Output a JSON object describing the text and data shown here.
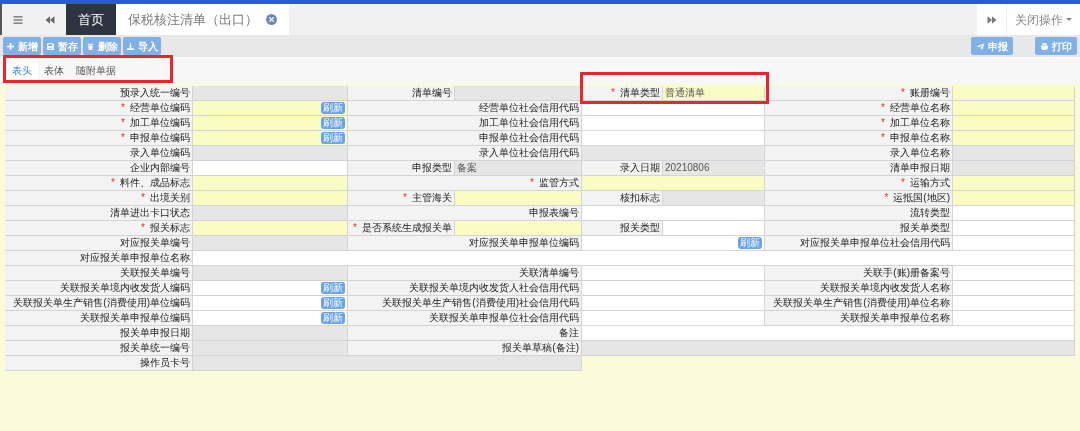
{
  "top_tabs": [
    {
      "kind": "menu"
    },
    {
      "kind": "back"
    },
    {
      "kind": "text",
      "label": "首页",
      "selected": true
    },
    {
      "kind": "text",
      "label": "保税核注清单（出口）",
      "selected": false,
      "closable": true
    }
  ],
  "top_right": {
    "close_ops": "关闭操作"
  },
  "toolbar": {
    "left": [
      {
        "kind": "plus",
        "label": "新增"
      },
      {
        "kind": "save",
        "label": "暂存"
      },
      {
        "kind": "trash",
        "label": "删除"
      },
      {
        "kind": "import",
        "label": "导入"
      }
    ],
    "right": [
      {
        "kind": "send",
        "label": "申报"
      },
      {
        "kind": "print",
        "label": "打印"
      }
    ]
  },
  "sub_tabs": [
    {
      "label": "表头",
      "selected": true
    },
    {
      "label": "表体",
      "selected": false
    },
    {
      "label": "随附单据",
      "selected": false
    }
  ],
  "form_rows": [
    {
      "kind": "eight",
      "cells": [
        {
          "kind": "label",
          "text": "预录入统一编号"
        },
        {
          "kind": "readonly"
        },
        {
          "kind": "label",
          "text": "清单编号"
        },
        {
          "kind": "readonly"
        },
        {
          "kind": "label",
          "text": "清单类型",
          "mark": "*"
        },
        {
          "kind": "required",
          "value": "普通清单"
        },
        {
          "kind": "label",
          "text": "账册编号",
          "mark": "*"
        },
        {
          "kind": "required"
        }
      ]
    },
    {
      "kind": "six",
      "cells": [
        {
          "kind": "label",
          "text": "经营单位编码",
          "mark": "*"
        },
        {
          "kind": "required",
          "refresh": "刷新"
        },
        {
          "kind": "label",
          "text": "经营单位社会信用代码"
        },
        {
          "kind": "editable"
        },
        {
          "kind": "label",
          "text": "经营单位名称",
          "mark": "*"
        },
        {
          "kind": "required"
        }
      ]
    },
    {
      "kind": "six",
      "cells": [
        {
          "kind": "label",
          "text": "加工单位编码",
          "mark": "*"
        },
        {
          "kind": "required",
          "refresh": "刷新"
        },
        {
          "kind": "label",
          "text": "加工单位社会信用代码"
        },
        {
          "kind": "editable"
        },
        {
          "kind": "label",
          "text": "加工单位名称",
          "mark": "*"
        },
        {
          "kind": "required"
        }
      ]
    },
    {
      "kind": "six",
      "cells": [
        {
          "kind": "label",
          "text": "申报单位编码",
          "mark": "*"
        },
        {
          "kind": "required",
          "refresh": "刷新"
        },
        {
          "kind": "label",
          "text": "申报单位社会信用代码"
        },
        {
          "kind": "editable"
        },
        {
          "kind": "label",
          "text": "申报单位名称",
          "mark": "*"
        },
        {
          "kind": "required"
        }
      ]
    },
    {
      "kind": "six",
      "cells": [
        {
          "kind": "label",
          "text": "录入单位编码"
        },
        {
          "kind": "readonly"
        },
        {
          "kind": "label",
          "text": "录入单位社会信用代码"
        },
        {
          "kind": "readonly"
        },
        {
          "kind": "label",
          "text": "录入单位名称"
        },
        {
          "kind": "readonly"
        }
      ]
    },
    {
      "kind": "eight",
      "cells": [
        {
          "kind": "label",
          "text": "企业内部编号"
        },
        {
          "kind": "editable"
        },
        {
          "kind": "label",
          "text": "申报类型"
        },
        {
          "kind": "readonly",
          "value": "备案"
        },
        {
          "kind": "label",
          "text": "录入日期"
        },
        {
          "kind": "readonly",
          "value": "20210806"
        },
        {
          "kind": "label",
          "text": "清单申报日期"
        },
        {
          "kind": "readonly"
        }
      ]
    },
    {
      "kind": "six",
      "cells": [
        {
          "kind": "label",
          "text": "料件、成品标志",
          "mark": "*"
        },
        {
          "kind": "required"
        },
        {
          "kind": "label",
          "text": "监管方式",
          "mark": "*"
        },
        {
          "kind": "required"
        },
        {
          "kind": "label",
          "text": "运输方式",
          "mark": "*"
        },
        {
          "kind": "required"
        }
      ]
    },
    {
      "kind": "eight",
      "cells": [
        {
          "kind": "label",
          "text": "出境关别",
          "mark": "*"
        },
        {
          "kind": "required"
        },
        {
          "kind": "label",
          "text": "主管海关",
          "mark": "*"
        },
        {
          "kind": "required"
        },
        {
          "kind": "label",
          "text": "核扣标志"
        },
        {
          "kind": "readonly"
        },
        {
          "kind": "label",
          "text": "运抵国(地区)",
          "mark": "*"
        },
        {
          "kind": "required"
        }
      ]
    },
    {
      "kind": "six",
      "cells": [
        {
          "kind": "label",
          "text": "清单进出卡口状态"
        },
        {
          "kind": "readonly"
        },
        {
          "kind": "label",
          "text": "申报表编号"
        },
        {
          "kind": "editable"
        },
        {
          "kind": "label",
          "text": "流转类型"
        },
        {
          "kind": "editable"
        }
      ]
    },
    {
      "kind": "eight",
      "cells": [
        {
          "kind": "label",
          "text": "报关标志",
          "mark": "*"
        },
        {
          "kind": "required"
        },
        {
          "kind": "label",
          "text": "是否系统生成报关单",
          "mark": "*"
        },
        {
          "kind": "required"
        },
        {
          "kind": "label",
          "text": "报关类型"
        },
        {
          "kind": "editable"
        },
        {
          "kind": "label",
          "text": "报关单类型"
        },
        {
          "kind": "editable"
        }
      ]
    },
    {
      "kind": "six",
      "cells": [
        {
          "kind": "label",
          "text": "对应报关单编号"
        },
        {
          "kind": "readonly"
        },
        {
          "kind": "label",
          "text": "对应报关单申报单位编码"
        },
        {
          "kind": "editable",
          "refresh": "刷新"
        },
        {
          "kind": "label",
          "text": "对应报关单申报单位社会信用代码"
        },
        {
          "kind": "editable"
        }
      ]
    },
    {
      "kind": "two",
      "cells": [
        {
          "kind": "label",
          "text": "对应报关单申报单位名称"
        },
        {
          "kind": "editable"
        }
      ]
    },
    {
      "kind": "six",
      "cells": [
        {
          "kind": "label",
          "text": "关联报关单编号"
        },
        {
          "kind": "readonly"
        },
        {
          "kind": "label",
          "text": "关联清单编号"
        },
        {
          "kind": "editable"
        },
        {
          "kind": "label",
          "text": "关联手(账)册备案号"
        },
        {
          "kind": "editable"
        }
      ]
    },
    {
      "kind": "six",
      "cells": [
        {
          "kind": "label",
          "text": "关联报关单境内收发货人编码"
        },
        {
          "kind": "editable",
          "refresh": "刷新"
        },
        {
          "kind": "label",
          "text": "关联报关单境内收发货人社会信用代码"
        },
        {
          "kind": "editable"
        },
        {
          "kind": "label",
          "text": "关联报关单境内收发货人名称"
        },
        {
          "kind": "editable"
        }
      ]
    },
    {
      "kind": "six",
      "cells": [
        {
          "kind": "label",
          "text": "关联报关单生产销售(消费使用)单位编码"
        },
        {
          "kind": "editable",
          "refresh": "刷新"
        },
        {
          "kind": "label",
          "text": "关联报关单生产销售(消费使用)社会信用代码"
        },
        {
          "kind": "editable"
        },
        {
          "kind": "label",
          "text": "关联报关单生产销售(消费使用)单位名称"
        },
        {
          "kind": "editable"
        }
      ]
    },
    {
      "kind": "six",
      "cells": [
        {
          "kind": "label",
          "text": "关联报关单申报单位编码"
        },
        {
          "kind": "editable",
          "refresh": "刷新"
        },
        {
          "kind": "label",
          "text": "关联报关单申报单位社会信用代码"
        },
        {
          "kind": "editable"
        },
        {
          "kind": "label",
          "text": "关联报关单申报单位名称"
        },
        {
          "kind": "editable"
        }
      ]
    },
    {
      "kind": "four",
      "cells": [
        {
          "kind": "label",
          "text": "报关单申报日期"
        },
        {
          "kind": "readonly"
        },
        {
          "kind": "label",
          "text": "备注"
        },
        {
          "kind": "editable"
        }
      ]
    },
    {
      "kind": "four",
      "cells": [
        {
          "kind": "label",
          "text": "报关单统一编号"
        },
        {
          "kind": "readonly"
        },
        {
          "kind": "label",
          "text": "报关单草稿(备注)"
        },
        {
          "kind": "readonly"
        }
      ]
    },
    {
      "kind": "tail",
      "cells": [
        {
          "kind": "label",
          "text": "操作员卡号"
        },
        {
          "kind": "readonly"
        }
      ]
    }
  ]
}
